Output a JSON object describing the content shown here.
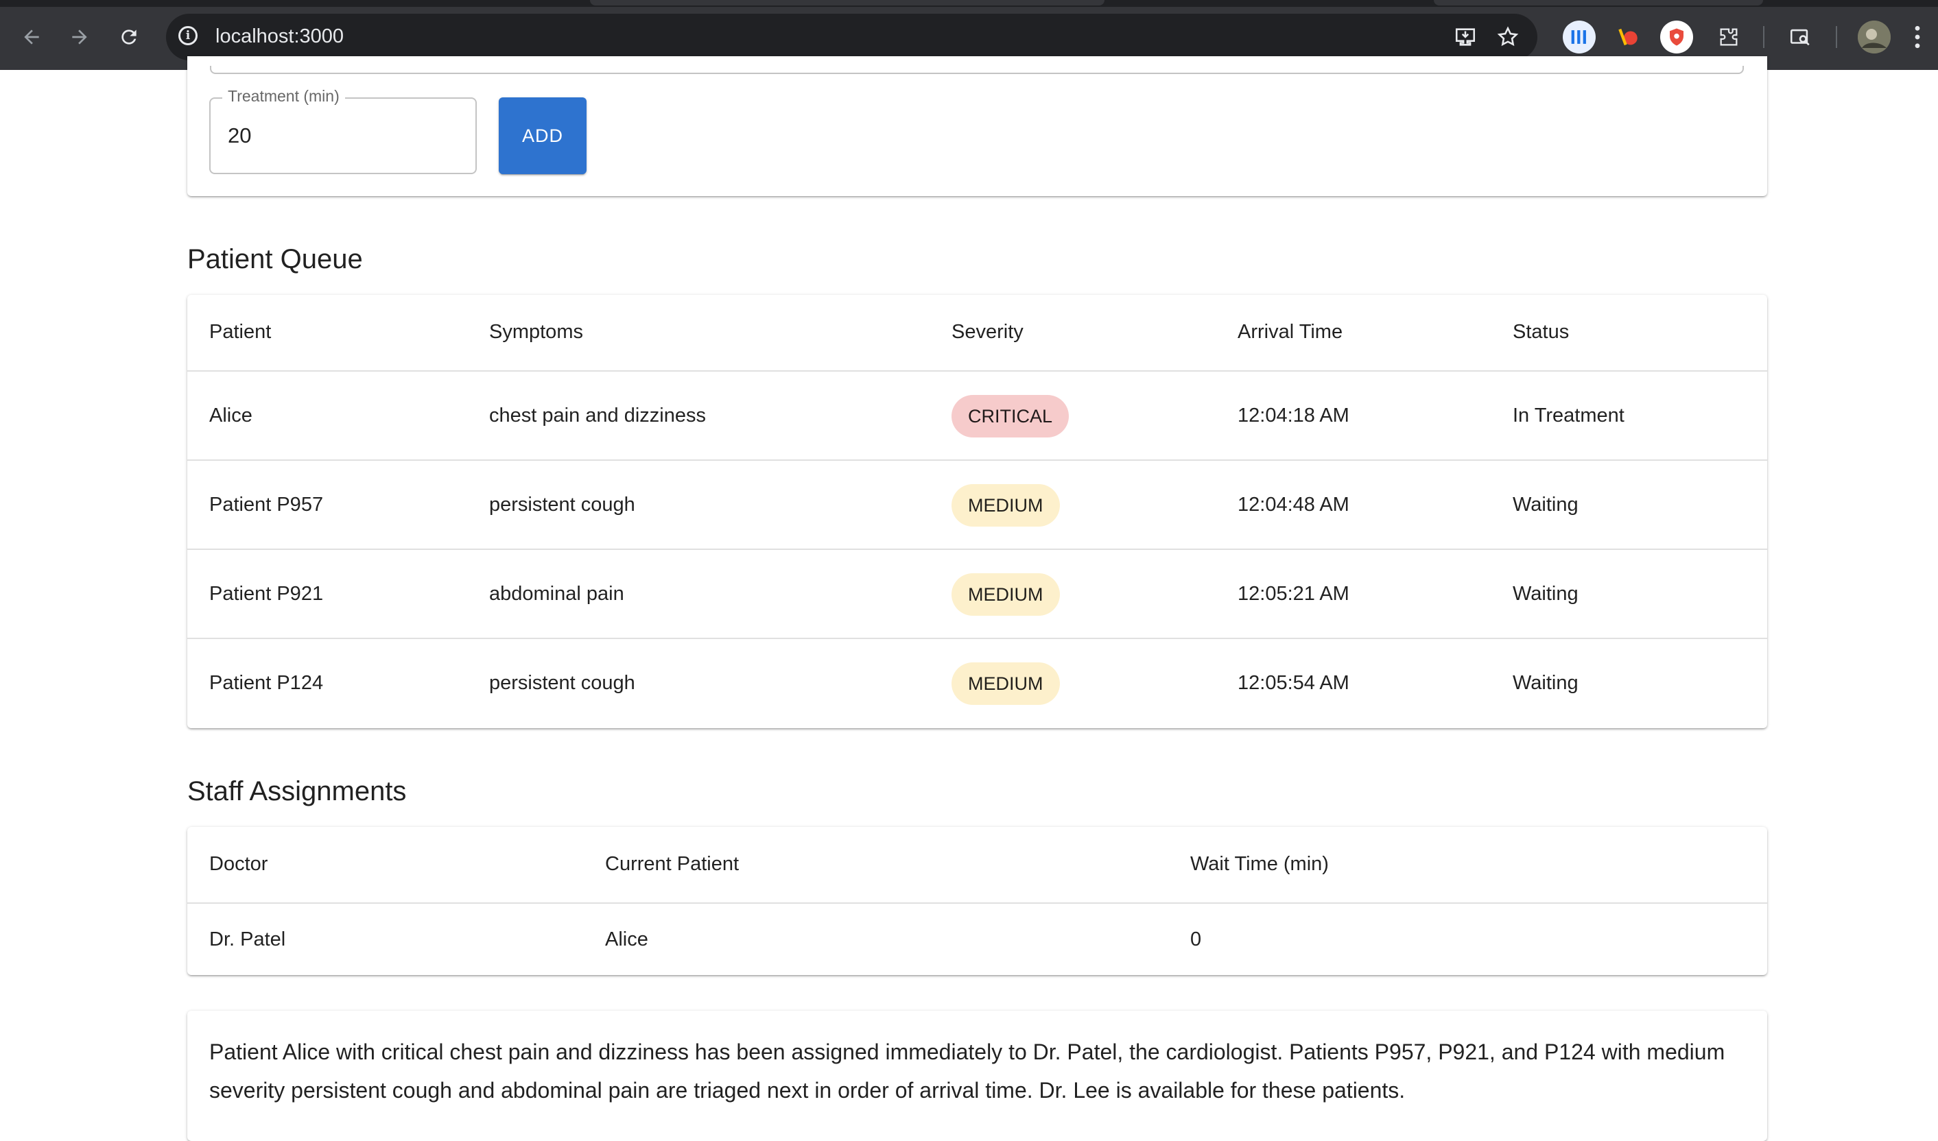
{
  "browser": {
    "url": "localhost:3000",
    "back_icon": "arrow-back-icon",
    "forward_icon": "arrow-forward-icon",
    "reload_icon": "reload-icon",
    "info_icon": "info-icon",
    "install_icon": "install-app-icon",
    "bookmark_icon": "star-icon",
    "extensions": [
      "extension-bars-icon",
      "extension-honey-icon",
      "extension-shield-icon",
      "puzzle-icon"
    ],
    "tab_search_icon": "tab-search-icon",
    "profile_icon": "avatar",
    "menu_icon": "kebab-menu-icon"
  },
  "form": {
    "treatment_label": "Treatment (min)",
    "treatment_value": "20",
    "add_label": "ADD"
  },
  "patient_queue": {
    "title": "Patient Queue",
    "headers": [
      "Patient",
      "Symptoms",
      "Severity",
      "Arrival Time",
      "Status"
    ],
    "rows": [
      {
        "patient": "Alice",
        "symptoms": "chest pain and dizziness",
        "severity": "CRITICAL",
        "arrival": "12:04:18 AM",
        "status": "In Treatment"
      },
      {
        "patient": "Patient P957",
        "symptoms": "persistent cough",
        "severity": "MEDIUM",
        "arrival": "12:04:48 AM",
        "status": "Waiting"
      },
      {
        "patient": "Patient P921",
        "symptoms": "abdominal pain",
        "severity": "MEDIUM",
        "arrival": "12:05:21 AM",
        "status": "Waiting"
      },
      {
        "patient": "Patient P124",
        "symptoms": "persistent cough",
        "severity": "MEDIUM",
        "arrival": "12:05:54 AM",
        "status": "Waiting"
      }
    ]
  },
  "severity_colors": {
    "CRITICAL": "#f6cbcb",
    "MEDIUM": "#fdf0cc"
  },
  "staff": {
    "title": "Staff Assignments",
    "headers": [
      "Doctor",
      "Current Patient",
      "Wait Time (min)"
    ],
    "rows": [
      {
        "doctor": "Dr. Patel",
        "current_patient": "Alice",
        "wait": "0"
      }
    ]
  },
  "summary": {
    "text": "Patient Alice with critical chest pain and dizziness has been assigned immediately to Dr. Patel, the cardiologist. Patients P957, P921, and P124 with medium severity persistent cough and abdominal pain are triaged next in order of arrival time. Dr. Lee is available for these patients."
  },
  "colors": {
    "primary": "#2e73cf",
    "chrome_bg": "#35363a",
    "omnibox_bg": "#202124"
  }
}
